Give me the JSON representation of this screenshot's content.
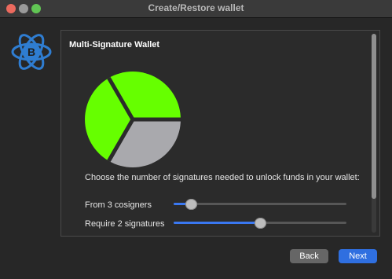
{
  "window": {
    "title": "Create/Restore wallet"
  },
  "logo": {
    "icon": "electrum-bitcoin-logo-icon",
    "color": "#2f7dd1"
  },
  "panel": {
    "title": "Multi-Signature Wallet",
    "prompt": "Choose the number of signatures needed to unlock funds in your wallet:"
  },
  "pie": {
    "type": "pie",
    "slices": [
      {
        "state": "required",
        "color": "#66ff00"
      },
      {
        "state": "required",
        "color": "#66ff00"
      },
      {
        "state": "not-required",
        "color": "#a9a9ad"
      }
    ]
  },
  "cosigners": {
    "label": "From 3 cosigners",
    "value": 3,
    "position_fraction": 0.1
  },
  "signatures": {
    "label": "Require 2 signatures",
    "value": 2,
    "position_fraction": 0.5
  },
  "buttons": {
    "back": "Back",
    "next": "Next"
  },
  "colors": {
    "accent": "#2f6fe0",
    "slider_fill": "#3a78f2",
    "required_slice": "#66ff00",
    "remaining_slice": "#a9a9ad"
  }
}
